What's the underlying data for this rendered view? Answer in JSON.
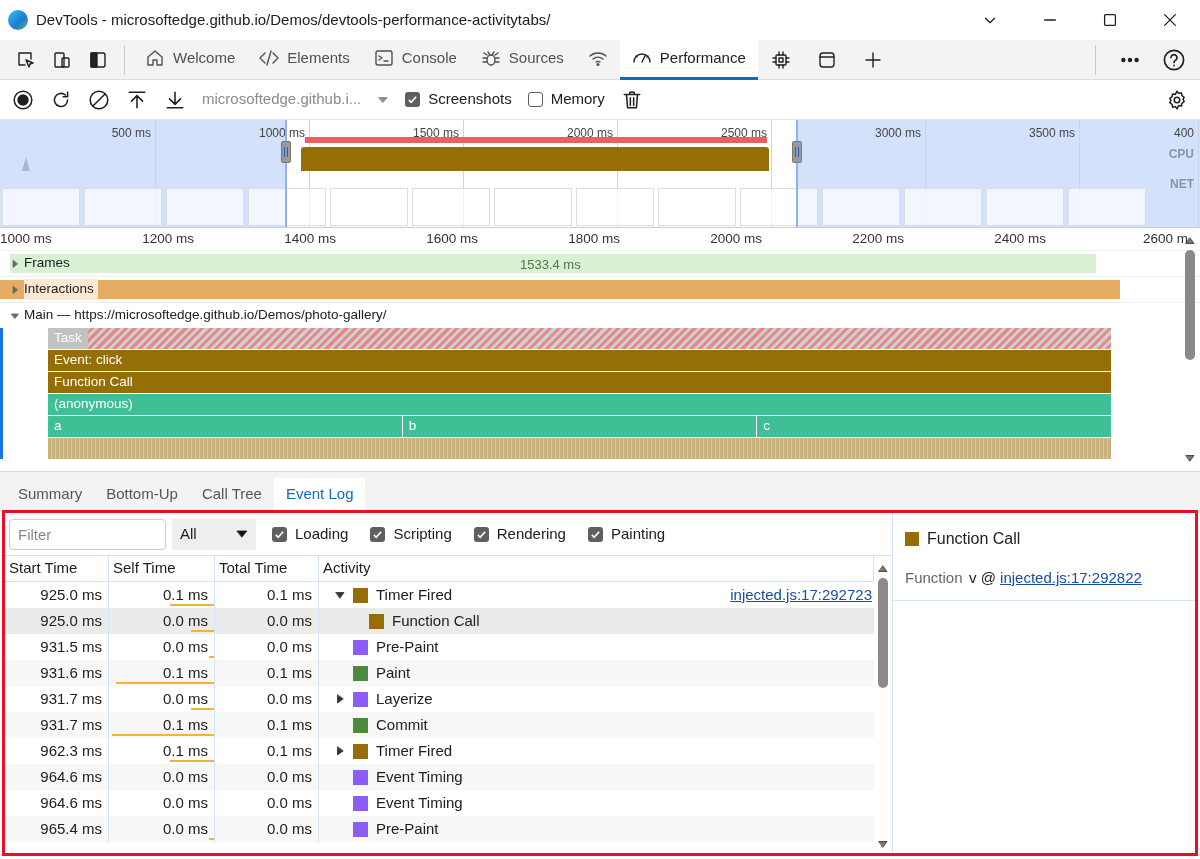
{
  "window": {
    "title": "DevTools - microsoftedge.github.io/Demos/devtools-performance-activitytabs/"
  },
  "tabs": [
    {
      "label": "Welcome",
      "selected": false
    },
    {
      "label": "Elements",
      "selected": false
    },
    {
      "label": "Console",
      "selected": false
    },
    {
      "label": "Sources",
      "selected": false
    },
    {
      "selected": false
    },
    {
      "label": "Performance",
      "selected": true
    }
  ],
  "toolbar": {
    "url": "microsoftedge.github.i...",
    "checkboxes": [
      {
        "label": "Screenshots",
        "checked": true
      },
      {
        "label": "Memory",
        "checked": false
      }
    ]
  },
  "overview": {
    "ticks": [
      "500 ms",
      "1000 ms",
      "1500 ms",
      "2000 ms",
      "2500 ms",
      "3000 ms",
      "3500 ms",
      "400"
    ],
    "lanes": [
      "CPU",
      "NET"
    ]
  },
  "timeline": {
    "ticks": [
      "1000 ms",
      "1200 ms",
      "1400 ms",
      "1600 ms",
      "1800 ms",
      "2000 ms",
      "2200 ms",
      "2400 ms",
      "2600 m"
    ],
    "tracks": [
      {
        "kind": "frames",
        "label": "Frames",
        "expanded": false,
        "value": "1533.4 ms"
      },
      {
        "kind": "interactions",
        "label": "Interactions",
        "expanded": false
      },
      {
        "kind": "main",
        "label": "Main — https://microsoftedge.github.io/Demos/photo-gallery/",
        "expanded": true
      }
    ],
    "flame": [
      {
        "kind": "task",
        "segments": [
          "Task"
        ]
      },
      {
        "kind": "scripting",
        "segments": [
          "Event: click"
        ]
      },
      {
        "kind": "scripting",
        "segments": [
          "Function Call"
        ]
      },
      {
        "kind": "js",
        "segments": [
          "(anonymous)"
        ]
      },
      {
        "kind": "js",
        "segments": [
          "a",
          "b",
          "c"
        ]
      },
      {
        "kind": "strip"
      }
    ]
  },
  "bottom_tabs": [
    {
      "label": "Summary",
      "selected": false
    },
    {
      "label": "Bottom-Up",
      "selected": false
    },
    {
      "label": "Call Tree",
      "selected": false
    },
    {
      "label": "Event Log",
      "selected": true
    }
  ],
  "event_log": {
    "filter": {
      "placeholder": "Filter"
    },
    "dropdown": "All",
    "categories": [
      {
        "label": "Loading",
        "checked": true
      },
      {
        "label": "Scripting",
        "checked": true
      },
      {
        "label": "Rendering",
        "checked": true
      },
      {
        "label": "Painting",
        "checked": true
      }
    ],
    "columns": [
      "Start Time",
      "Self Time",
      "Total Time",
      "Activity"
    ],
    "rows": [
      {
        "start": "925.0 ms",
        "self": "0.1 ms",
        "level": 0.42,
        "total": "0.1 ms",
        "activity": "Timer Fired",
        "color": "#966e07",
        "expanded": true,
        "selected": false,
        "source": "injected.js:17:292723",
        "children": [
          {
            "start": "925.0 ms",
            "self": "0.0 ms",
            "level": 0.22,
            "total": "0.0 ms",
            "activity": "Function Call",
            "color": "#966e07",
            "selected": true
          }
        ]
      },
      {
        "start": "931.5 ms",
        "self": "0.0 ms",
        "level": 0.05,
        "total": "0.0 ms",
        "activity": "Pre-Paint",
        "color": "#8b5cf6",
        "selected": false
      },
      {
        "start": "931.6 ms",
        "self": "0.1 ms",
        "level": 0.93,
        "total": "0.1 ms",
        "activity": "Paint",
        "color": "#4a8a3d",
        "selected": false
      },
      {
        "start": "931.7 ms",
        "self": "0.0 ms",
        "level": 0.22,
        "total": "0.0 ms",
        "activity": "Layerize",
        "color": "#8b5cf6",
        "expanded": false,
        "selected": false
      },
      {
        "start": "931.7 ms",
        "self": "0.1 ms",
        "level": 0.97,
        "total": "0.1 ms",
        "activity": "Commit",
        "color": "#4a8a3d",
        "selected": false
      },
      {
        "start": "962.3 ms",
        "self": "0.1 ms",
        "level": 0.42,
        "total": "0.1 ms",
        "activity": "Timer Fired",
        "color": "#966e07",
        "expanded": false,
        "selected": false
      },
      {
        "start": "964.6 ms",
        "self": "0.0 ms",
        "total": "0.0 ms",
        "activity": "Event Timing",
        "color": "#8b5cf6",
        "selected": false
      },
      {
        "start": "964.6 ms",
        "self": "0.0 ms",
        "total": "0.0 ms",
        "activity": "Event Timing",
        "color": "#8b5cf6",
        "selected": false
      },
      {
        "start": "965.4 ms",
        "self": "0.0 ms",
        "level": 0.05,
        "total": "0.0 ms",
        "activity": "Pre-Paint",
        "color": "#8b5cf6",
        "selected": false
      }
    ]
  },
  "details": {
    "title": "Function Call",
    "color": "#966e07",
    "label": "Function",
    "value": "v @ ",
    "link": "injected.js:17:292822"
  }
}
